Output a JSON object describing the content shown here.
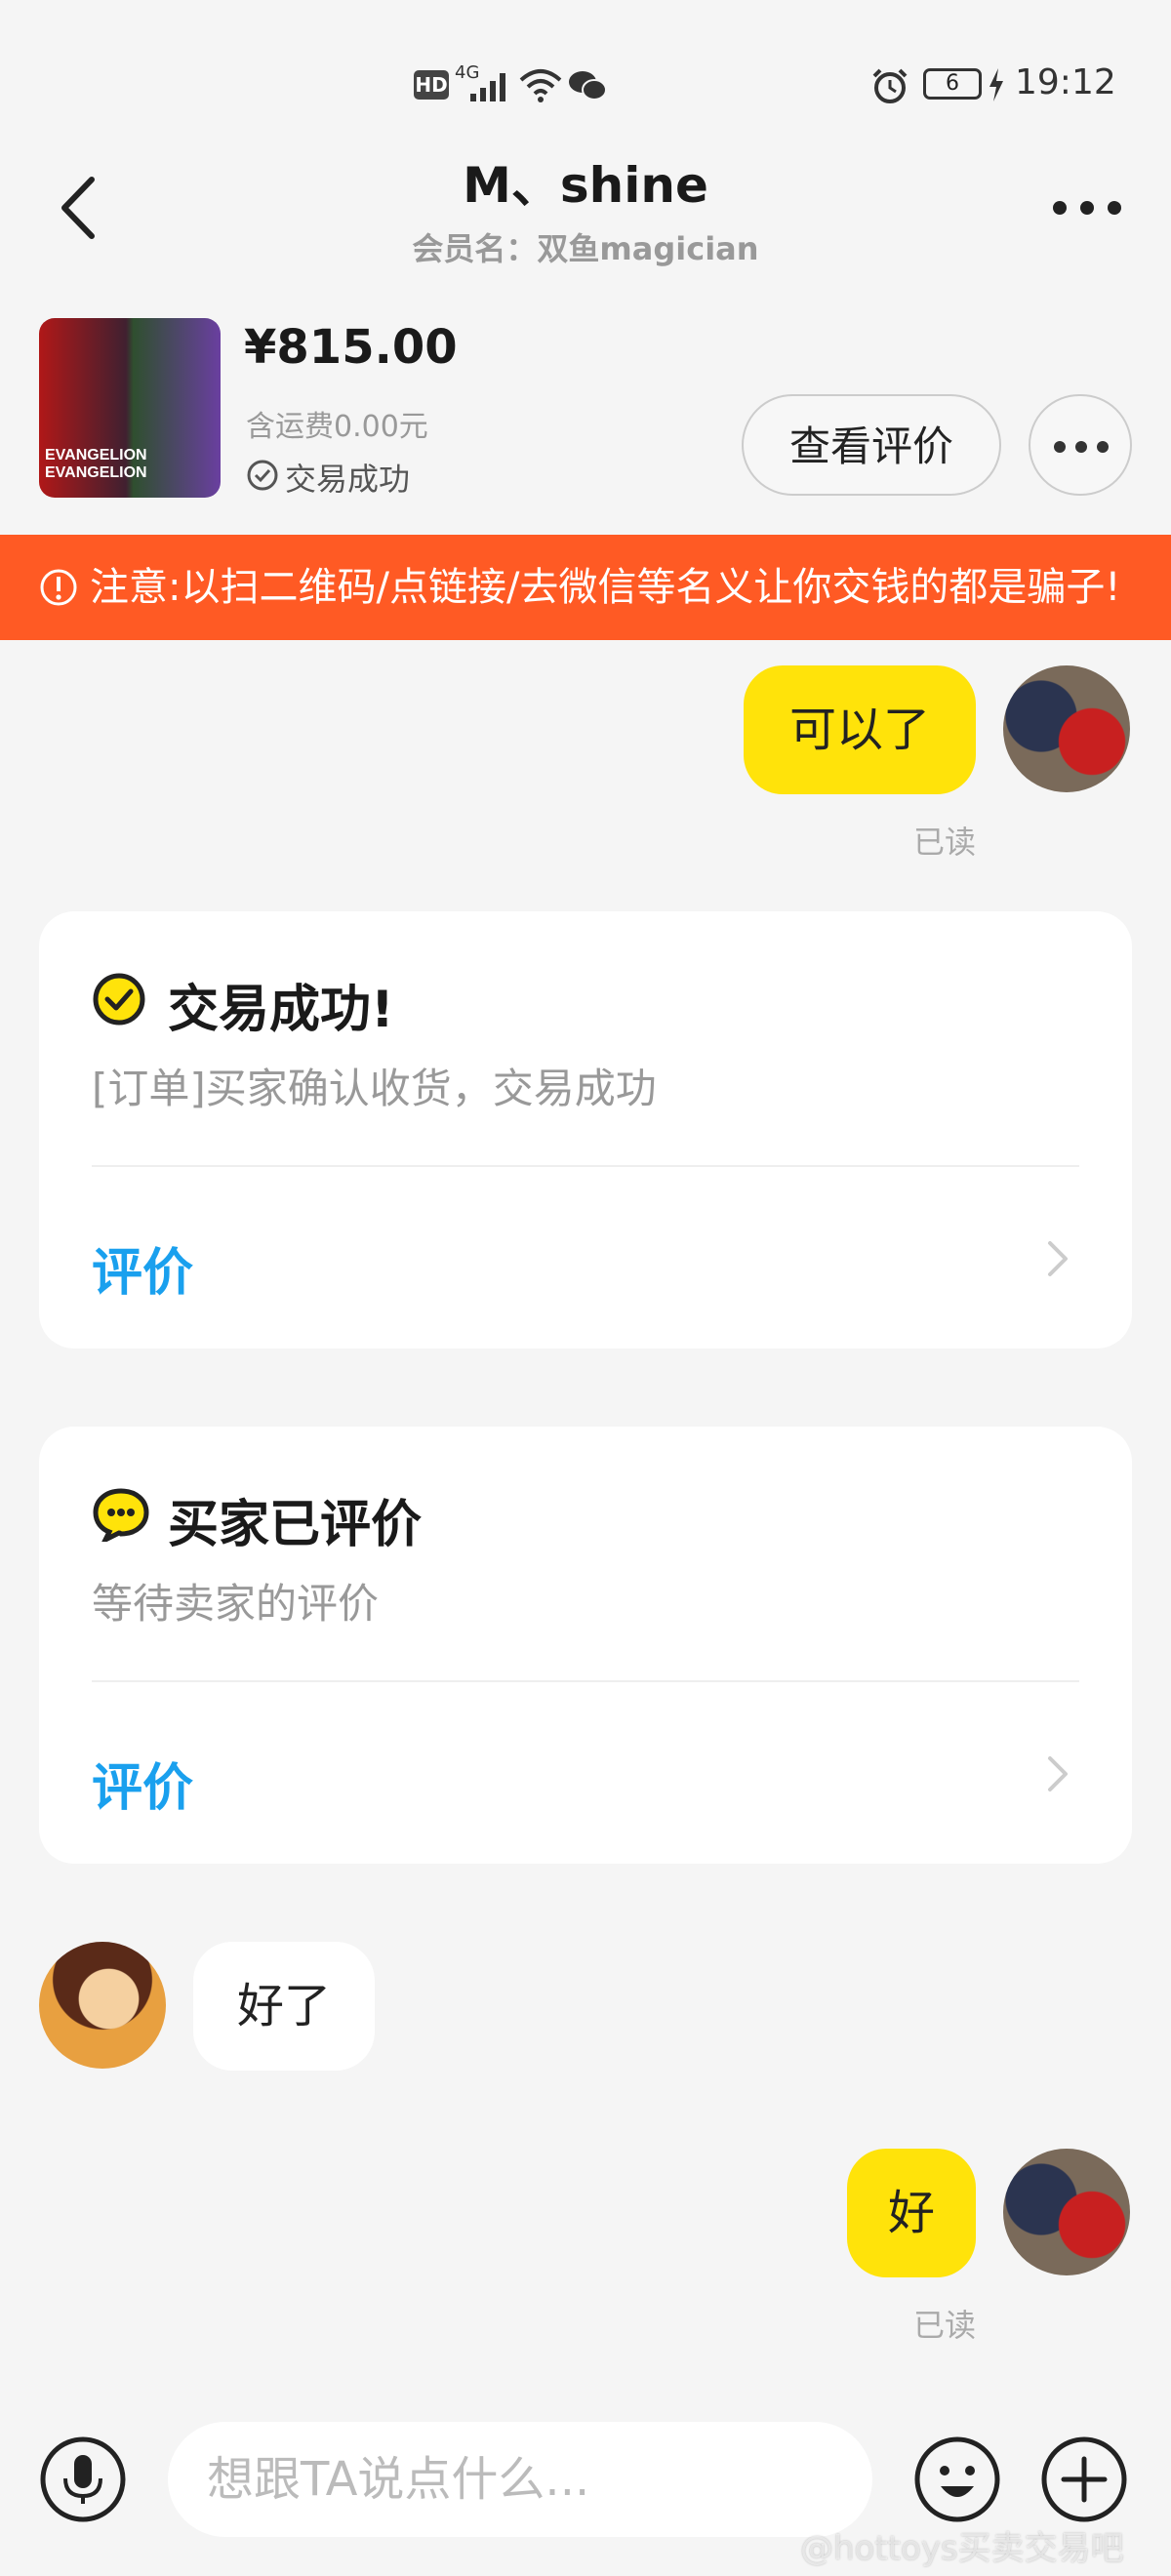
{
  "status_bar": {
    "hd": "HD",
    "network": "4G",
    "battery": "6",
    "time": "19:12"
  },
  "header": {
    "title": "M、shine",
    "subtitle": "会员名：双鱼magician"
  },
  "product": {
    "price": "¥815.00",
    "shipping": "含运费0.00元",
    "status": "交易成功",
    "review_button": "查看评价"
  },
  "warning": {
    "text": "注意:以扫二维码/点链接/去微信等名义让你交钱的都是骗子!"
  },
  "messages": {
    "m1": {
      "text": "可以了",
      "read": "已读"
    },
    "m2": {
      "text": "好了"
    },
    "m3": {
      "text": "好",
      "read": "已读"
    }
  },
  "cards": {
    "trade": {
      "title": "交易成功!",
      "subtitle": "[订单]买家确认收货，交易成功",
      "action": "评价"
    },
    "review": {
      "title": "买家已评价",
      "subtitle": "等待卖家的评价",
      "action": "评价"
    }
  },
  "input": {
    "placeholder": "想跟TA说点什么..."
  },
  "watermark": "@hottoys买卖交易吧",
  "colors": {
    "accent_yellow": "#ffe30a",
    "warning_orange": "#ff5a24",
    "link_blue": "#1aa0ee"
  }
}
